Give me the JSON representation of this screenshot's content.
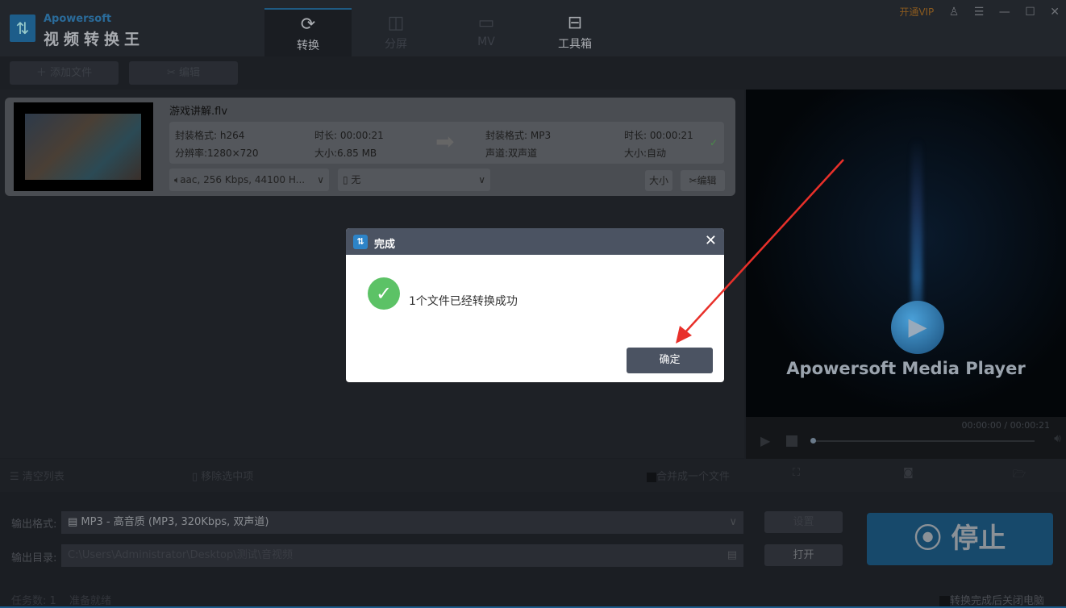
{
  "app": {
    "brand": "Apowersoft",
    "name": "视频转换王"
  },
  "tabs": [
    {
      "label": "转换",
      "icon": "refresh-icon"
    },
    {
      "label": "分屏",
      "icon": "split-screen-icon"
    },
    {
      "label": "MV",
      "icon": "tv-icon"
    },
    {
      "label": "工具箱",
      "icon": "toolbox-icon"
    }
  ],
  "window": {
    "vip": "开通VIP"
  },
  "toolbar": {
    "add_file": "添加文件",
    "edit": "编辑"
  },
  "file": {
    "name": "游戏讲解.flv",
    "src_format": "封装格式: h264",
    "src_duration": "时长: 00:00:21",
    "resolution": "分辨率:1280×720",
    "src_size": "大小:6.85 MB",
    "dst_format": "封装格式: MP3",
    "dst_duration": "时长: 00:00:21",
    "channels": "声道:双声道",
    "dst_size": "大小:自动",
    "audio_track": "aac, 256 Kbps, 44100 H...",
    "subtitle": "无",
    "size_btn": "大小",
    "edit_btn": "编辑"
  },
  "player": {
    "title": "Apowersoft Media Player",
    "time": "00:00:00 / 00:00:21",
    "progress": 0
  },
  "actions": {
    "clear": "清空列表",
    "remove": "移除选中项",
    "merge": "合并成一个文件"
  },
  "output": {
    "format_label": "输出格式:",
    "format_value": "MP3 - 高音质 (MP3, 320Kbps, 双声道)",
    "dir_label": "输出目录:",
    "dir_value": "C:\\Users\\Administrator\\Desktop\\测试\\音视频",
    "settings": "设置",
    "open": "打开",
    "stop": "停止"
  },
  "status": {
    "tasks": "任务数: 1",
    "state": "准备就绪",
    "shutdown": "转换完成后关闭电脑"
  },
  "dialog": {
    "title": "完成",
    "message": "1个文件已经转换成功",
    "ok": "确定"
  }
}
